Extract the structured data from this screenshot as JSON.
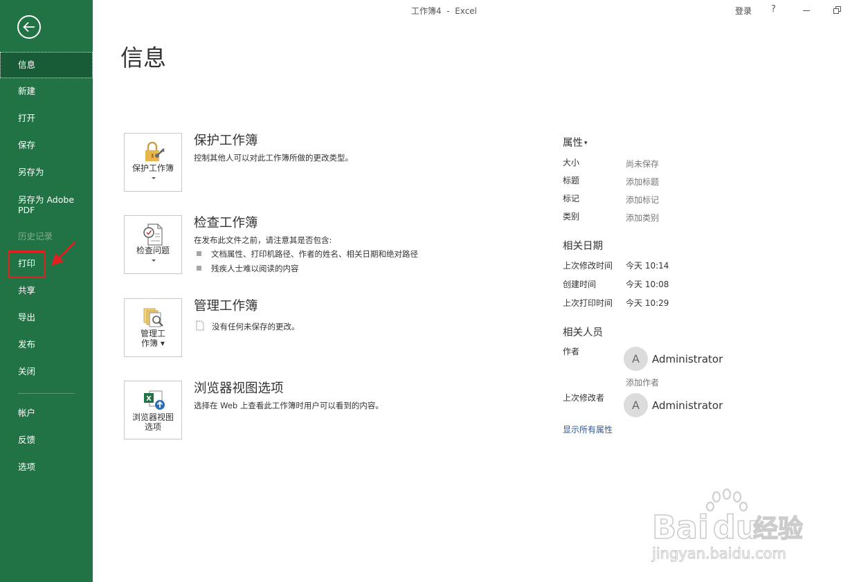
{
  "window": {
    "title": "工作簿4  -  Excel",
    "login": "登录",
    "help": "?"
  },
  "sidebar": {
    "items": [
      {
        "label": "信息"
      },
      {
        "label": "新建"
      },
      {
        "label": "打开"
      },
      {
        "label": "保存"
      },
      {
        "label": "另存为"
      },
      {
        "label": "另存为 Adobe PDF"
      },
      {
        "label": "历史记录"
      },
      {
        "label": "打印"
      },
      {
        "label": "共享"
      },
      {
        "label": "导出"
      },
      {
        "label": "发布"
      },
      {
        "label": "关闭"
      },
      {
        "label": "帐户"
      },
      {
        "label": "反馈"
      },
      {
        "label": "选项"
      }
    ]
  },
  "main": {
    "title": "信息",
    "sections": [
      {
        "tile_label": "保护工作簿",
        "title": "保护工作簿",
        "description": "控制其他人可以对此工作簿所做的更改类型。"
      },
      {
        "tile_label": "检查问题",
        "title": "检查工作簿",
        "description": "在发布此文件之前，请注意其是否包含:",
        "bullets": [
          "文档属性、打印机路径、作者的姓名、相关日期和绝对路径",
          "残疾人士难以阅读的内容"
        ]
      },
      {
        "tile_label": "管理工作簿",
        "title": "管理工作簿",
        "description": "没有任何未保存的更改。"
      },
      {
        "tile_label": "浏览器视图选项",
        "title": "浏览器视图选项",
        "description": "选择在 Web 上查看此工作簿时用户可以看到的内容。"
      }
    ]
  },
  "properties": {
    "heading": "属性",
    "rows": [
      {
        "label": "大小",
        "value": "尚未保存"
      },
      {
        "label": "标题",
        "value": "添加标题"
      },
      {
        "label": "标记",
        "value": "添加标记"
      },
      {
        "label": "类别",
        "value": "添加类别"
      }
    ],
    "dates_heading": "相关日期",
    "dates": [
      {
        "label": "上次修改时间",
        "value": "今天 10:14"
      },
      {
        "label": "创建时间",
        "value": "今天 10:08"
      },
      {
        "label": "上次打印时间",
        "value": "今天 10:29"
      }
    ],
    "people_heading": "相关人员",
    "author_label": "作者",
    "author_initial": "A",
    "author_name": "Administrator",
    "add_author": "添加作者",
    "last_modified_by_label": "上次修改者",
    "last_modified_initial": "A",
    "last_modified_name": "Administrator",
    "show_all": "显示所有属性"
  },
  "watermark": {
    "brand": "Bai",
    "brand_suffix": "经验",
    "url": "jingyan.baidu.com"
  },
  "colors": {
    "sidebar_bg": "#217346",
    "sidebar_active": "#185c37",
    "highlight_red": "#e02020",
    "link_blue": "#2b5797"
  }
}
